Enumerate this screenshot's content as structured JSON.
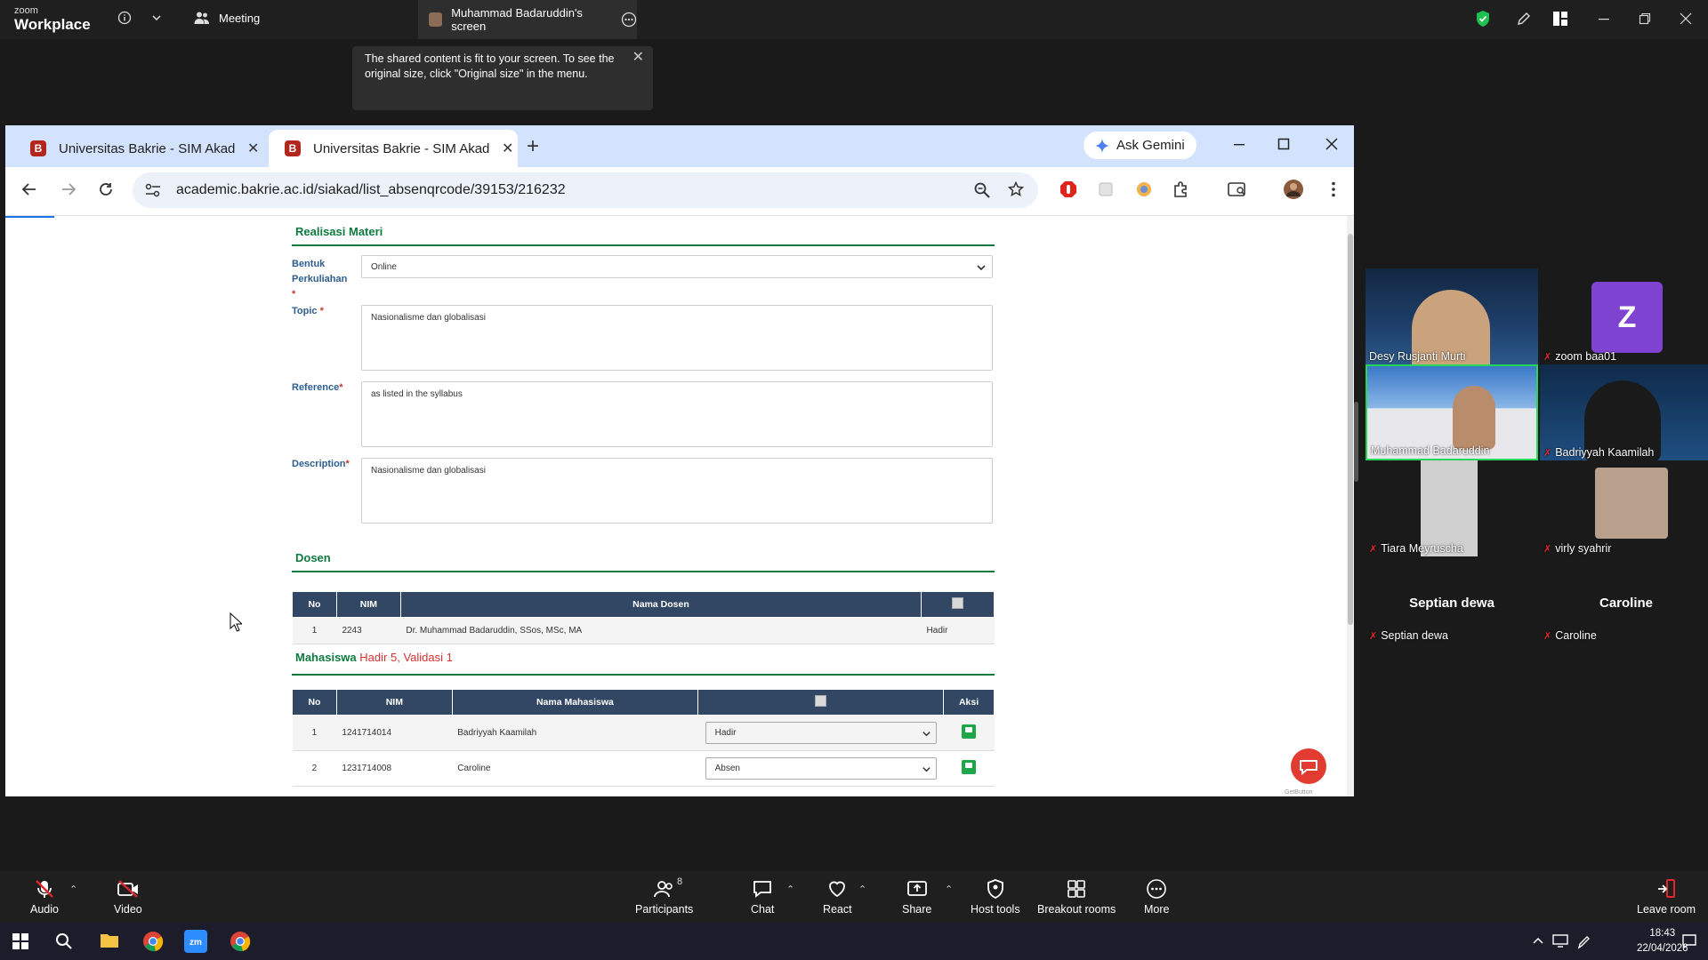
{
  "zoom": {
    "brand_small": "zoom",
    "brand": "Workplace",
    "meeting_label": "Meeting",
    "share_title": "Muhammad Badaruddin's screen",
    "tooltip": "The shared content is fit to your screen. To see the original size, click \"Original size\" in the menu."
  },
  "browser": {
    "tabs": [
      {
        "title": "Universitas Bakrie - SIM Akaden"
      },
      {
        "title": "Universitas Bakrie - SIM Akaden"
      }
    ],
    "favicon_letter": "B",
    "ask_gemini": "Ask Gemini",
    "url": "academic.bakrie.ac.id/siakad/list_absenqrcode/39153/216232"
  },
  "form": {
    "realisasi_title": "Realisasi Materi",
    "bentuk_label": "Bentuk Perkuliahan",
    "required_mark": "*",
    "bentuk_value": "Online",
    "topic_label": "Topic",
    "topic_value": "Nasionalisme dan globalisasi",
    "reference_label": "Reference",
    "reference_value": "as listed in the syllabus",
    "description_label": "Description",
    "description_value": "Nasionalisme dan globalisasi"
  },
  "dosen": {
    "title": "Dosen",
    "headers": {
      "no": "No",
      "nim": "NIM",
      "nama": "Nama Dosen"
    },
    "rows": [
      {
        "no": "1",
        "nim": "2243",
        "nama": "Dr. Muhammad Badaruddin, SSos, MSc, MA",
        "status": "Hadir"
      }
    ]
  },
  "mahasiswa": {
    "title": "Mahasiswa",
    "hadir_label": "Hadir",
    "hadir_count": "5",
    "sep": ",",
    "validasi_label": "Validasi",
    "validasi_count": "1",
    "headers": {
      "no": "No",
      "nim": "NIM",
      "nama": "Nama Mahasiswa",
      "aksi": "Aksi"
    },
    "rows": [
      {
        "no": "1",
        "nim": "1241714014",
        "nama": "Badriyyah Kaamilah",
        "status": "Hadir"
      },
      {
        "no": "2",
        "nim": "1231714008",
        "nama": "Caroline",
        "status": "Absen"
      }
    ]
  },
  "getbutton_label": "GetButton",
  "participants": {
    "tiles": [
      {
        "name": "Desy Rusjanti Murti",
        "muted": false
      },
      {
        "name": "zoom baa01",
        "muted": true,
        "initial": "Z"
      },
      {
        "name": "Muhammad Badaruddin",
        "muted": false
      },
      {
        "name": "Badriyyah Kaamilah",
        "muted": true
      },
      {
        "name": "Tiara Meyruscha",
        "muted": true
      },
      {
        "name": "virly syahrir",
        "muted": true
      }
    ],
    "audio_only": [
      {
        "name": "Septian dewa",
        "muted": true
      },
      {
        "name": "Caroline",
        "muted": true
      }
    ]
  },
  "toolbar": {
    "audio": "Audio",
    "video": "Video",
    "participants": "Participants",
    "participants_count": "8",
    "chat": "Chat",
    "react": "React",
    "share": "Share",
    "host_tools": "Host tools",
    "breakout": "Breakout rooms",
    "more": "More",
    "leave": "Leave room"
  },
  "taskbar": {
    "time": "18:43",
    "date": "22/04/2026"
  },
  "colors": {
    "brand_green": "#0d7a3e",
    "table_header": "#314763",
    "tab_bar": "#d3e3fd",
    "zoom_bg": "#1a1a1a",
    "active_speaker": "#23d959",
    "avatar_purple": "#7f43d1"
  }
}
